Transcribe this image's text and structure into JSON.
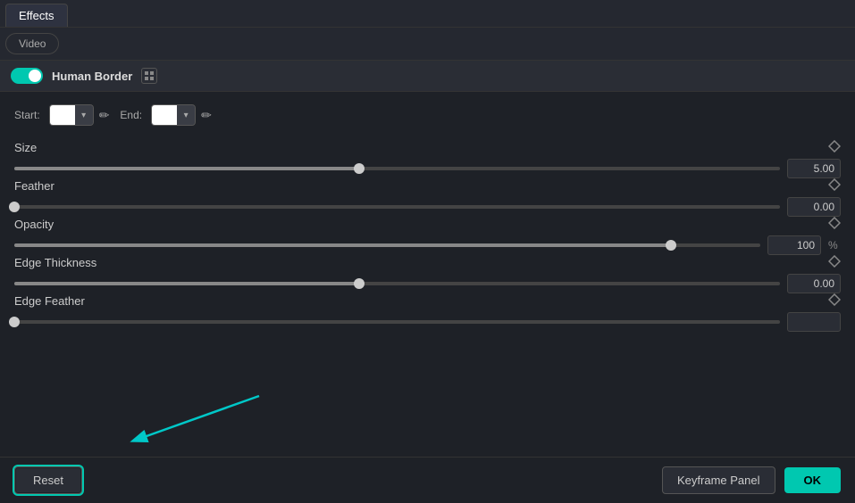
{
  "tabs": {
    "main": [
      {
        "label": "Effects",
        "active": true
      }
    ],
    "secondary": [
      {
        "label": "Video",
        "active": true
      }
    ]
  },
  "section": {
    "toggle_enabled": true,
    "title": "Human Border",
    "grid_icon_label": "grid"
  },
  "color_row": {
    "start_label": "Start:",
    "end_label": "End:",
    "start_color": "#ffffff",
    "end_color": "#ffffff"
  },
  "sliders": [
    {
      "id": "size",
      "label": "Size",
      "value": "5.00",
      "unit": "",
      "fill_pct": 45,
      "thumb_pct": 45
    },
    {
      "id": "feather",
      "label": "Feather",
      "value": "0.00",
      "unit": "",
      "fill_pct": 0,
      "thumb_pct": 0
    },
    {
      "id": "opacity",
      "label": "Opacity",
      "value": "100",
      "unit": "%",
      "fill_pct": 88,
      "thumb_pct": 88
    },
    {
      "id": "edge-thickness",
      "label": "Edge Thickness",
      "value": "0.00",
      "unit": "",
      "fill_pct": 45,
      "thumb_pct": 45
    },
    {
      "id": "edge-feather",
      "label": "Edge Feather",
      "value": "",
      "unit": "",
      "fill_pct": 0,
      "thumb_pct": 0
    }
  ],
  "bottom_bar": {
    "reset_label": "Reset",
    "keyframe_label": "Keyframe Panel",
    "ok_label": "OK"
  }
}
